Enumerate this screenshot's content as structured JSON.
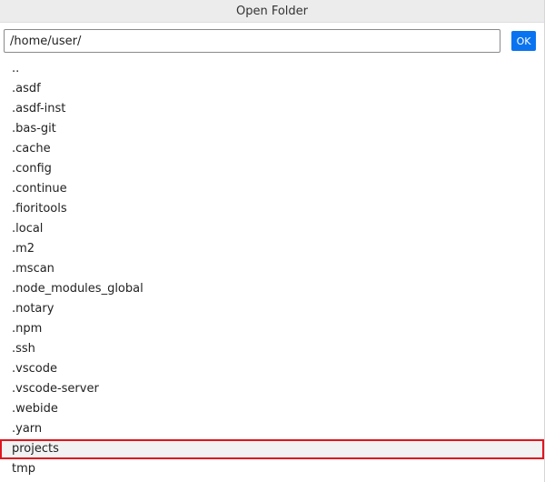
{
  "dialog": {
    "title": "Open Folder"
  },
  "path": {
    "value": "/home/user/",
    "ok_label": "OK"
  },
  "folders": [
    "..",
    ".asdf",
    ".asdf-inst",
    ".bas-git",
    ".cache",
    ".config",
    ".continue",
    ".fioritools",
    ".local",
    ".m2",
    ".mscan",
    ".node_modules_global",
    ".notary",
    ".npm",
    ".ssh",
    ".vscode",
    ".vscode-server",
    ".webide",
    ".yarn",
    "projects",
    "tmp"
  ],
  "highlighted_folder": "projects",
  "colors": {
    "accent": "#0a74f0",
    "highlight_border": "#e0141e"
  }
}
